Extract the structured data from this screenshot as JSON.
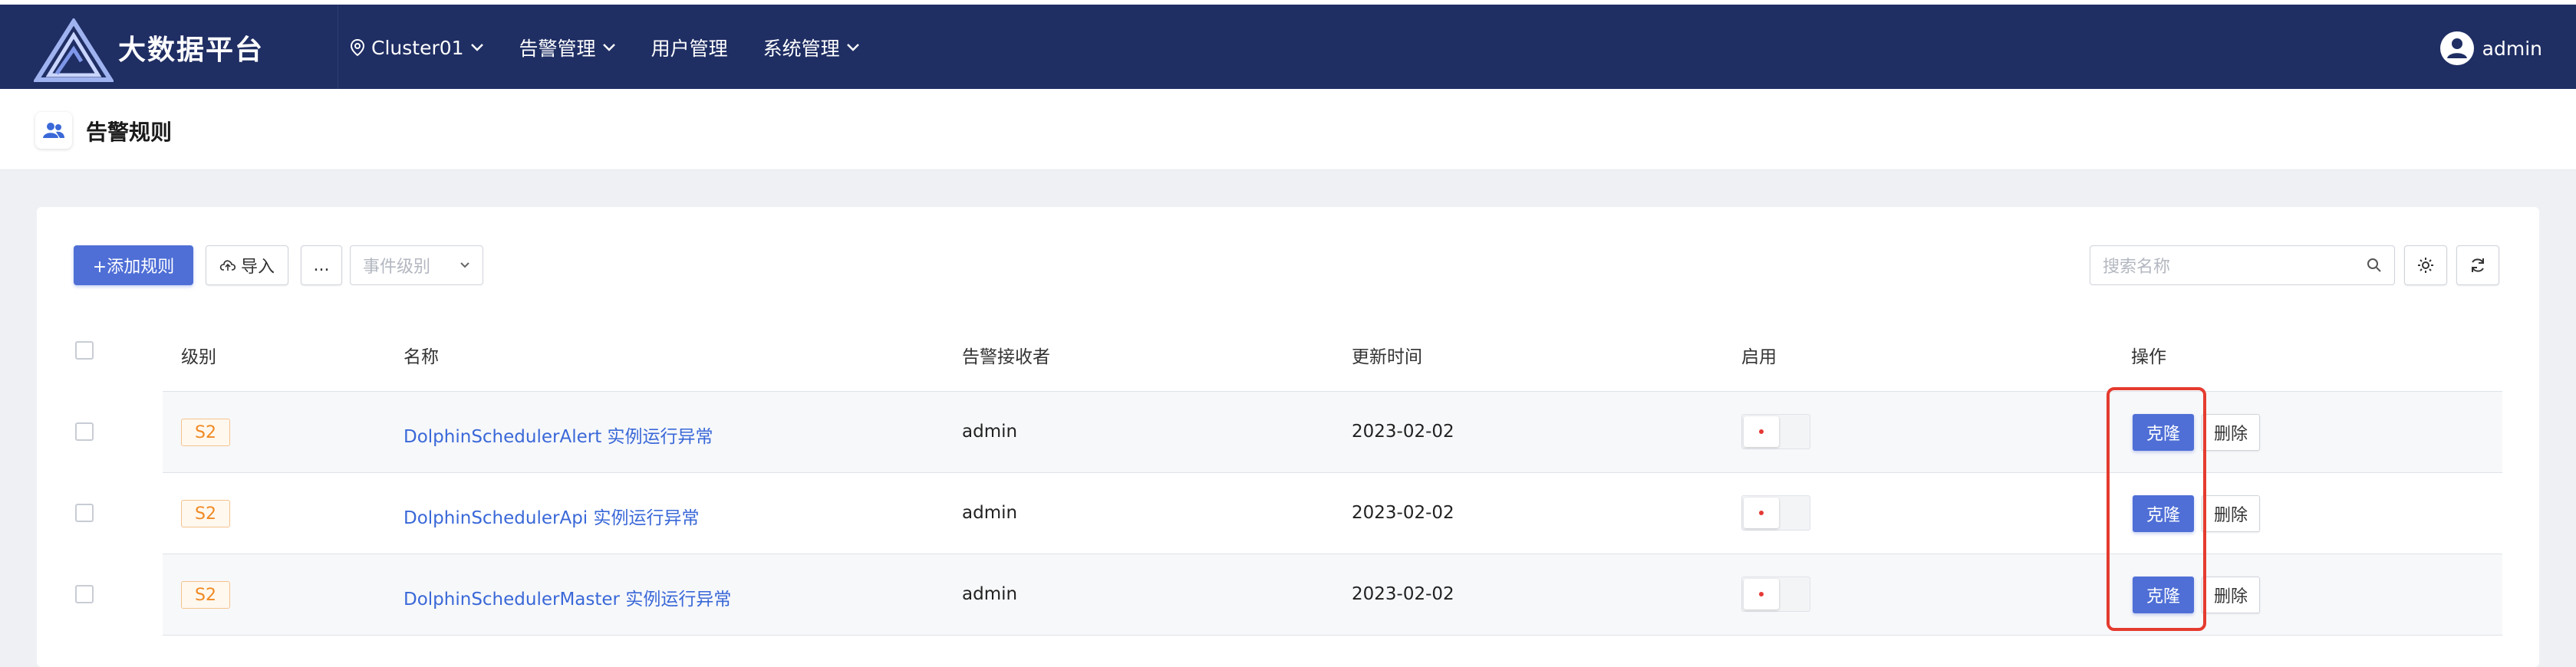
{
  "app": {
    "brand": "大数据平台",
    "accent_color": "#1f2e63",
    "primary_color": "#4f6fd6"
  },
  "nav": {
    "cluster": "Cluster01",
    "alert_mgmt": "告警管理",
    "user_mgmt": "用户管理",
    "system_mgmt": "系统管理",
    "user": "admin"
  },
  "page": {
    "title": "告警规则"
  },
  "toolbar": {
    "add_label": "+添加规则",
    "import_label": "导入",
    "more_label": "...",
    "level_placeholder": "事件级别",
    "search_placeholder": "搜索名称"
  },
  "table": {
    "headers": {
      "level": "级别",
      "name": "名称",
      "receiver": "告警接收者",
      "updated": "更新时间",
      "enabled": "启用",
      "actions": "操作"
    },
    "rows": [
      {
        "level": "S2",
        "name": "DolphinSchedulerAlert 实例运行异常",
        "receiver": "admin",
        "updated": "2023-02-02",
        "enabled": false,
        "clone": "克隆",
        "delete": "删除"
      },
      {
        "level": "S2",
        "name": "DolphinSchedulerApi 实例运行异常",
        "receiver": "admin",
        "updated": "2023-02-02",
        "enabled": false,
        "clone": "克隆",
        "delete": "删除"
      },
      {
        "level": "S2",
        "name": "DolphinSchedulerMaster 实例运行异常",
        "receiver": "admin",
        "updated": "2023-02-02",
        "enabled": false,
        "clone": "克隆",
        "delete": "删除"
      }
    ]
  },
  "icons": {
    "logo": "triangle-logo-icon",
    "location": "location-pin-icon",
    "chevron": "chevron-down-icon",
    "avatar": "user-avatar-icon",
    "page": "users-icon",
    "import": "cloud-upload-icon",
    "search": "search-icon",
    "settings": "gear-icon",
    "refresh": "refresh-icon"
  }
}
